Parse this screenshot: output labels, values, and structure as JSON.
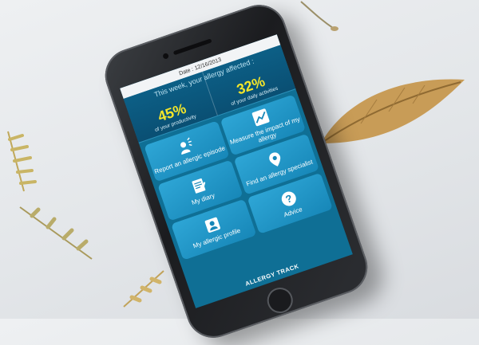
{
  "header": {
    "date": "Date : 12/16/2013"
  },
  "summary": {
    "title": "This week, your allergy affected :",
    "stats": [
      {
        "value": "45%",
        "caption": "of your productivity"
      },
      {
        "value": "32%",
        "caption": "of your daily activities"
      }
    ]
  },
  "menu": {
    "report": "Report an allergic episode",
    "measure": "Measure the impact of my allergy",
    "diary": "My diary",
    "find": "Find an allergy specialist",
    "profile": "My allergic profile",
    "advice": "Advice"
  },
  "brand": {
    "name": "ALLERGY TRACK"
  },
  "colors": {
    "screen_bg": "#0f6f95",
    "tile": "#2ea6d6",
    "highlight": "#f3e52a"
  },
  "icons": [
    "user-speaking-icon",
    "chart-icon",
    "map-pin-icon",
    "diary-icon",
    "question-icon",
    "profile-card-icon"
  ]
}
